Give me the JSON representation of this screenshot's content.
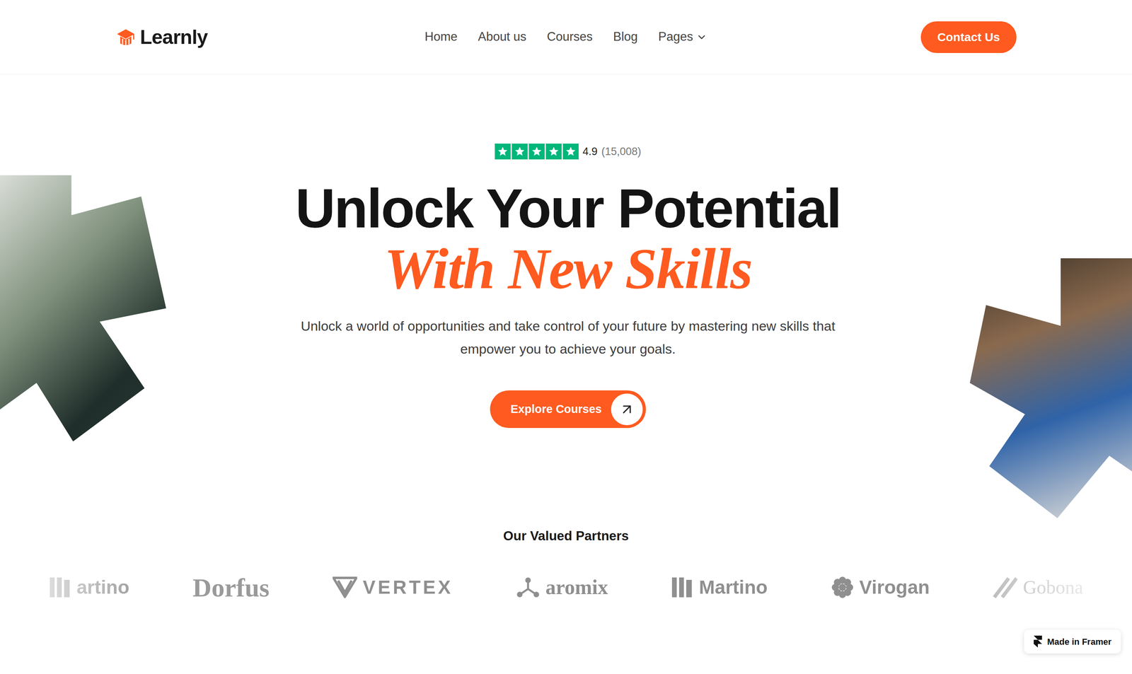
{
  "brand": {
    "name": "Learnly"
  },
  "nav": {
    "links": [
      {
        "label": "Home",
        "dropdown": false
      },
      {
        "label": "About us",
        "dropdown": false
      },
      {
        "label": "Courses",
        "dropdown": false
      },
      {
        "label": "Blog",
        "dropdown": false
      },
      {
        "label": "Pages",
        "dropdown": true
      }
    ],
    "cta": "Contact Us"
  },
  "hero": {
    "rating": {
      "stars": 5,
      "score": "4.9",
      "count": "(15,008)"
    },
    "title": "Unlock Your Potential",
    "highlight": "With New Skills",
    "subtitle": "Unlock a world of opportunities and take control of your future by mastering new skills that empower you to achieve your goals.",
    "cta": "Explore Courses"
  },
  "partners": {
    "title": "Our Valued Partners",
    "logos": [
      {
        "name": "artino",
        "kind": "bars"
      },
      {
        "name": "Dorfus",
        "kind": "serif"
      },
      {
        "name": "VERTEX",
        "kind": "vertex"
      },
      {
        "name": "aromix",
        "kind": "aromix"
      },
      {
        "name": "Martino",
        "kind": "bars"
      },
      {
        "name": "Virogan",
        "kind": "flower"
      },
      {
        "name": "Gobona",
        "kind": "slash"
      }
    ]
  },
  "badge": {
    "label": "Made in Framer"
  }
}
